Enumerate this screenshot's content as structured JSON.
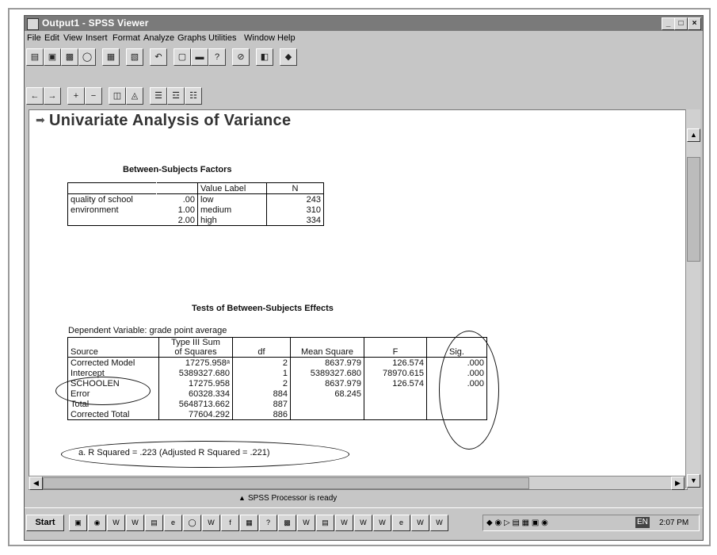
{
  "window": {
    "title": "Output1 - SPSS Viewer",
    "min_label": "_",
    "max_label": "□",
    "close_label": "×"
  },
  "menu": [
    "File",
    "Edit",
    "View",
    "Insert",
    "Format",
    "Analyze",
    "Graphs",
    "Utilities",
    "Window",
    "Help"
  ],
  "output": {
    "heading": "Univariate Analysis of Variance",
    "factors": {
      "title": "Between-Subjects Factors",
      "col_value_label": "Value Label",
      "col_n": "N",
      "variable_line1": "quality of school",
      "variable_line2": "environment",
      "rows": [
        {
          "value": ".00",
          "label": "low",
          "n": "243"
        },
        {
          "value": "1.00",
          "label": "medium",
          "n": "310"
        },
        {
          "value": "2.00",
          "label": "high",
          "n": "334"
        }
      ]
    },
    "effects": {
      "title": "Tests of Between-Subjects Effects",
      "dependent": "Dependent Variable: grade point average",
      "headers": {
        "source": "Source",
        "ss_line1": "Type III Sum",
        "ss_line2": "of Squares",
        "df": "df",
        "ms": "Mean Square",
        "f": "F",
        "sig": "Sig."
      },
      "rows": [
        {
          "source": "Corrected Model",
          "ss": "17275.958ᵃ",
          "df": "2",
          "ms": "8637.979",
          "f": "126.574",
          "sig": ".000"
        },
        {
          "source": "Intercept",
          "ss": "5389327.680",
          "df": "1",
          "ms": "5389327.680",
          "f": "78970.615",
          "sig": ".000"
        },
        {
          "source": "SCHOOLEN",
          "ss": "17275.958",
          "df": "2",
          "ms": "8637.979",
          "f": "126.574",
          "sig": ".000"
        },
        {
          "source": "Error",
          "ss": "60328.334",
          "df": "884",
          "ms": "68.245",
          "f": "",
          "sig": ""
        },
        {
          "source": "Total",
          "ss": "5648713.662",
          "df": "887",
          "ms": "",
          "f": "",
          "sig": ""
        },
        {
          "source": "Corrected Total",
          "ss": "77604.292",
          "df": "886",
          "ms": "",
          "f": "",
          "sig": ""
        }
      ],
      "footnote": "a. R Squared = .223 (Adjusted R Squared = .221)"
    }
  },
  "status": {
    "text": "SPSS Processor  is ready"
  },
  "taskbar": {
    "start_label": "Start",
    "clock": "2:07 PM",
    "lang": "EN"
  }
}
